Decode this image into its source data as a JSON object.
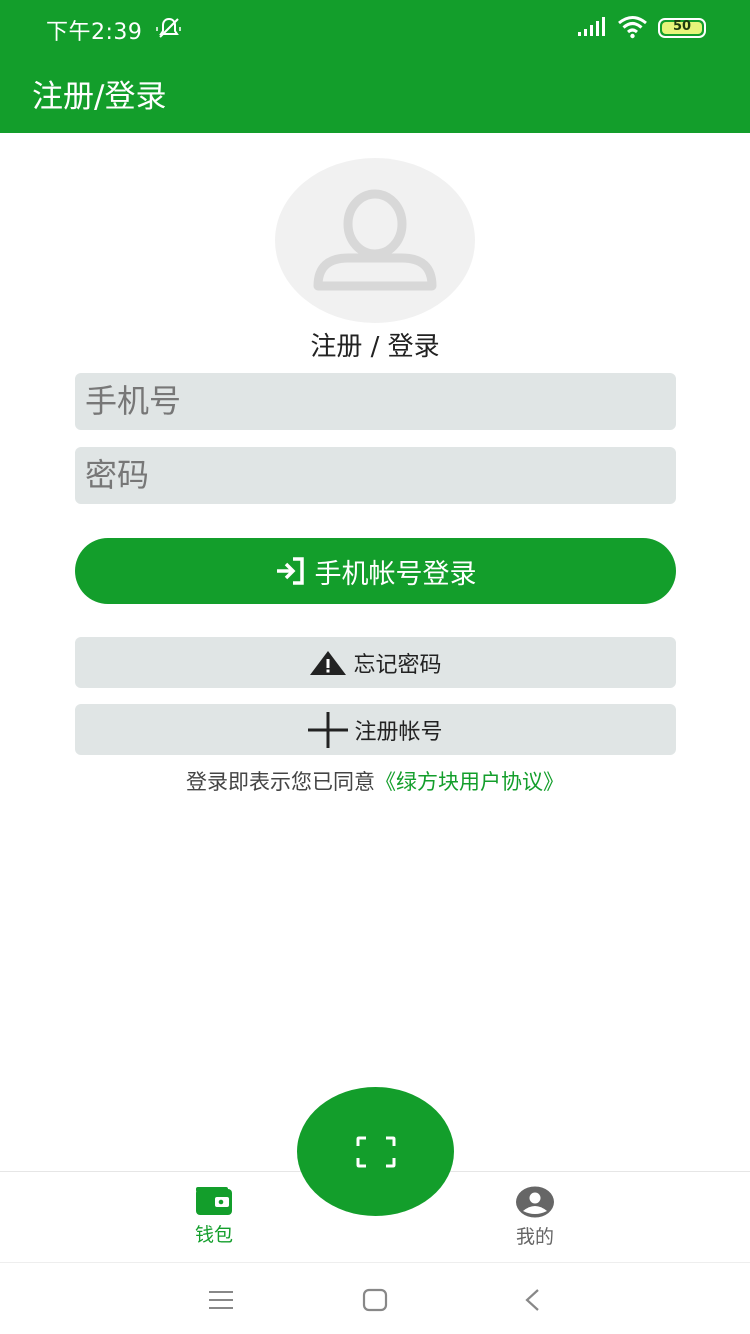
{
  "status_bar": {
    "time": "下午2:39",
    "battery_level": "50",
    "icons": [
      "mute-icon",
      "signal-icon",
      "wifi-icon",
      "battery-icon"
    ]
  },
  "app_bar": {
    "title": "注册/登录"
  },
  "avatar": {
    "icon": "user-icon",
    "caption": "注册 / 登录"
  },
  "form": {
    "phone_placeholder": "手机号",
    "password_placeholder": "密码",
    "login_label": "手机帐号登录",
    "login_icon": "login-arrow-icon"
  },
  "actions": {
    "forgot_label": "忘记密码",
    "forgot_icon": "warning-icon",
    "register_label": "注册帐号",
    "register_icon": "plus-icon"
  },
  "agreement": {
    "text": "登录即表示您已同意",
    "link": "《绿方块用户协议》"
  },
  "fab": {
    "icon": "scan-icon"
  },
  "bottom_nav": {
    "items": [
      {
        "label": "钱包",
        "icon": "wallet-icon",
        "active": true
      },
      {
        "label": "我的",
        "icon": "account-icon",
        "active": false
      }
    ]
  },
  "system_nav": {
    "icons": [
      "menu-icon",
      "home-icon",
      "back-icon"
    ]
  },
  "colors": {
    "primary": "#139e2b",
    "field_background": "#e0e5e5",
    "text_muted": "#777777"
  }
}
